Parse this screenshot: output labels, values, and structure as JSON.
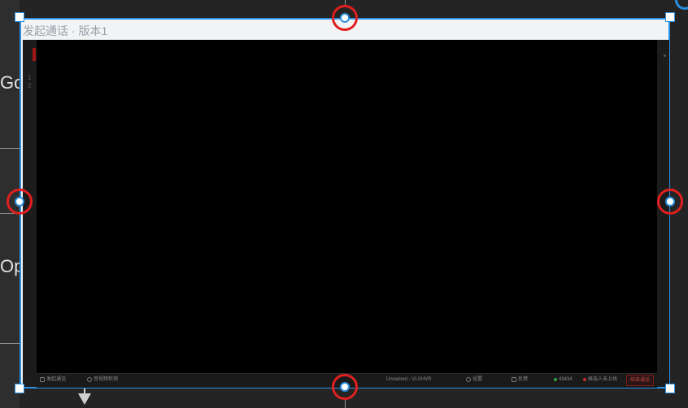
{
  "left_panel": {
    "text_top": "Go",
    "text_bottom": "Op"
  },
  "frame": {
    "title": "发起通话 · 版本1"
  },
  "toolbar": {
    "start_call": "发起通话",
    "av_check": "音视频检测",
    "session": "Unnamed - VLXHVR",
    "settings": "设置",
    "feedback": "反馈",
    "count": "43434",
    "waiting": "候选人未上线",
    "end_button": "结束通话"
  },
  "colors": {
    "selection": "#2b8fe0",
    "highlight_ring": "#e01f1f"
  }
}
